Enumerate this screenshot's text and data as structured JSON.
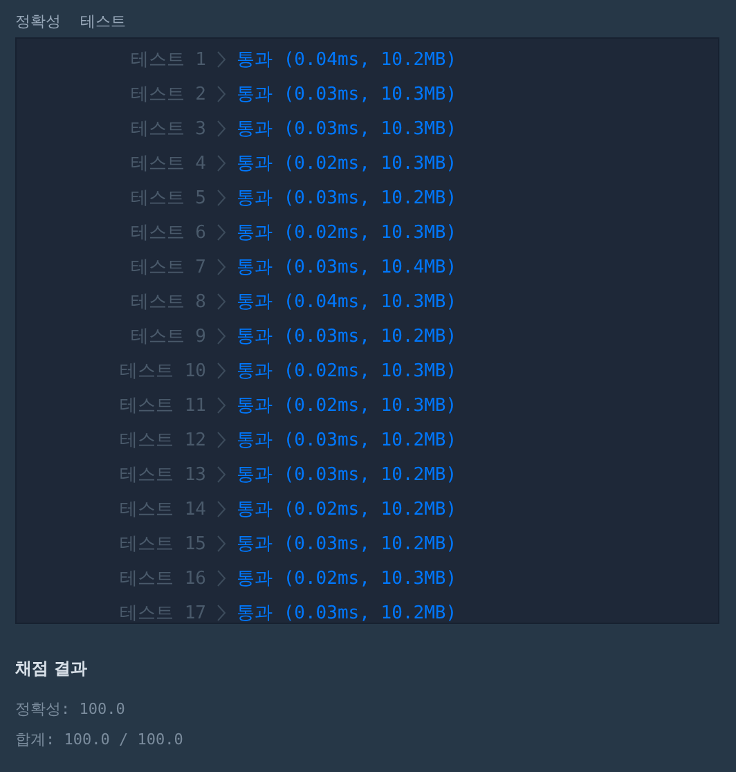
{
  "header": [
    "정확성",
    "테스트"
  ],
  "tests": [
    {
      "label": "테스트 1",
      "result": "통과 (0.04ms, 10.2MB)"
    },
    {
      "label": "테스트 2",
      "result": "통과 (0.03ms, 10.3MB)"
    },
    {
      "label": "테스트 3",
      "result": "통과 (0.03ms, 10.3MB)"
    },
    {
      "label": "테스트 4",
      "result": "통과 (0.02ms, 10.3MB)"
    },
    {
      "label": "테스트 5",
      "result": "통과 (0.03ms, 10.2MB)"
    },
    {
      "label": "테스트 6",
      "result": "통과 (0.02ms, 10.3MB)"
    },
    {
      "label": "테스트 7",
      "result": "통과 (0.03ms, 10.4MB)"
    },
    {
      "label": "테스트 8",
      "result": "통과 (0.04ms, 10.3MB)"
    },
    {
      "label": "테스트 9",
      "result": "통과 (0.03ms, 10.2MB)"
    },
    {
      "label": "테스트 10",
      "result": "통과 (0.02ms, 10.3MB)"
    },
    {
      "label": "테스트 11",
      "result": "통과 (0.02ms, 10.3MB)"
    },
    {
      "label": "테스트 12",
      "result": "통과 (0.03ms, 10.2MB)"
    },
    {
      "label": "테스트 13",
      "result": "통과 (0.03ms, 10.2MB)"
    },
    {
      "label": "테스트 14",
      "result": "통과 (0.02ms, 10.2MB)"
    },
    {
      "label": "테스트 15",
      "result": "통과 (0.03ms, 10.2MB)"
    },
    {
      "label": "테스트 16",
      "result": "통과 (0.02ms, 10.3MB)"
    },
    {
      "label": "테스트 17",
      "result": "통과 (0.03ms, 10.2MB)"
    }
  ],
  "grading": {
    "title": "채점 결과",
    "lines": [
      "정확성: 100.0",
      "합계: 100.0 / 100.0"
    ]
  }
}
